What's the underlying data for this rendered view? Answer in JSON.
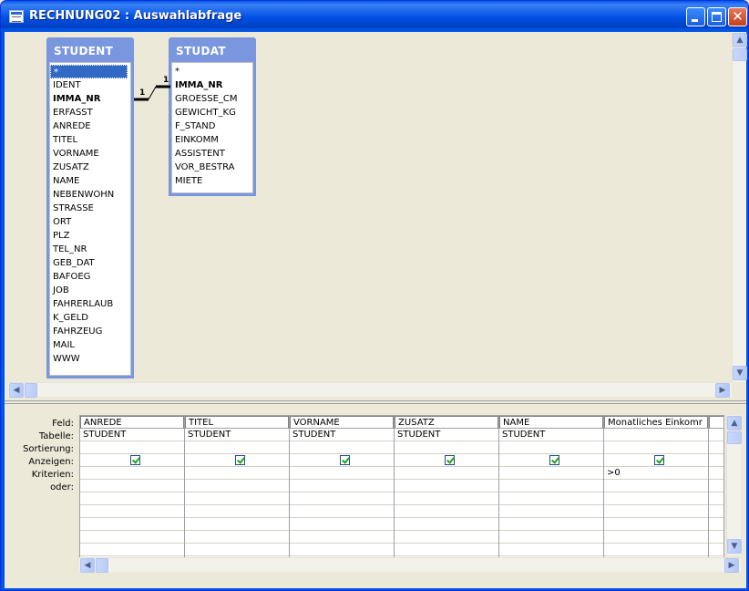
{
  "window": {
    "title": "RECHNUNG02 : Auswahlabfrage"
  },
  "field_lists": [
    {
      "name": "STUDENT",
      "fields": [
        {
          "label": "*",
          "key": false,
          "selected": true
        },
        {
          "label": "IDENT",
          "key": false
        },
        {
          "label": "IMMA_NR",
          "key": true
        },
        {
          "label": "ERFASST",
          "key": false
        },
        {
          "label": "ANREDE",
          "key": false
        },
        {
          "label": "TITEL",
          "key": false
        },
        {
          "label": "VORNAME",
          "key": false
        },
        {
          "label": "ZUSATZ",
          "key": false
        },
        {
          "label": "NAME",
          "key": false
        },
        {
          "label": "NEBENWOHN",
          "key": false
        },
        {
          "label": "STRASSE",
          "key": false
        },
        {
          "label": "ORT",
          "key": false
        },
        {
          "label": "PLZ",
          "key": false
        },
        {
          "label": "TEL_NR",
          "key": false
        },
        {
          "label": "GEB_DAT",
          "key": false
        },
        {
          "label": "BAFOEG",
          "key": false
        },
        {
          "label": "JOB",
          "key": false
        },
        {
          "label": "FAHRERLAUB",
          "key": false
        },
        {
          "label": "K_GELD",
          "key": false
        },
        {
          "label": "FAHRZEUG",
          "key": false
        },
        {
          "label": "MAIL",
          "key": false
        },
        {
          "label": "WWW",
          "key": false
        }
      ]
    },
    {
      "name": "STUDAT",
      "fields": [
        {
          "label": "*",
          "key": false
        },
        {
          "label": "IMMA_NR",
          "key": true
        },
        {
          "label": "GROESSE_CM",
          "key": false
        },
        {
          "label": "GEWICHT_KG",
          "key": false
        },
        {
          "label": "F_STAND",
          "key": false
        },
        {
          "label": "EINKOMM",
          "key": false
        },
        {
          "label": "ASSISTENT",
          "key": false
        },
        {
          "label": "VOR_BESTRA",
          "key": false
        },
        {
          "label": "MIETE",
          "key": false
        }
      ]
    }
  ],
  "relationship": {
    "left_label": "1",
    "right_label": "1"
  },
  "grid": {
    "row_labels": [
      "Feld:",
      "Tabelle:",
      "Sortierung:",
      "Anzeigen:",
      "Kriterien:",
      "oder:"
    ],
    "columns": [
      {
        "feld": "ANREDE",
        "tabelle": "STUDENT",
        "sortierung": "",
        "anzeigen": true,
        "kriterien": "",
        "oder": ""
      },
      {
        "feld": "TITEL",
        "tabelle": "STUDENT",
        "sortierung": "",
        "anzeigen": true,
        "kriterien": "",
        "oder": ""
      },
      {
        "feld": "VORNAME",
        "tabelle": "STUDENT",
        "sortierung": "",
        "anzeigen": true,
        "kriterien": "",
        "oder": ""
      },
      {
        "feld": "ZUSATZ",
        "tabelle": "STUDENT",
        "sortierung": "",
        "anzeigen": true,
        "kriterien": "",
        "oder": ""
      },
      {
        "feld": "NAME",
        "tabelle": "STUDENT",
        "sortierung": "",
        "anzeigen": true,
        "kriterien": "",
        "oder": ""
      },
      {
        "feld": "Monatliches Einkomr",
        "tabelle": "",
        "sortierung": "",
        "anzeigen": true,
        "kriterien": ">0",
        "oder": ""
      }
    ]
  }
}
